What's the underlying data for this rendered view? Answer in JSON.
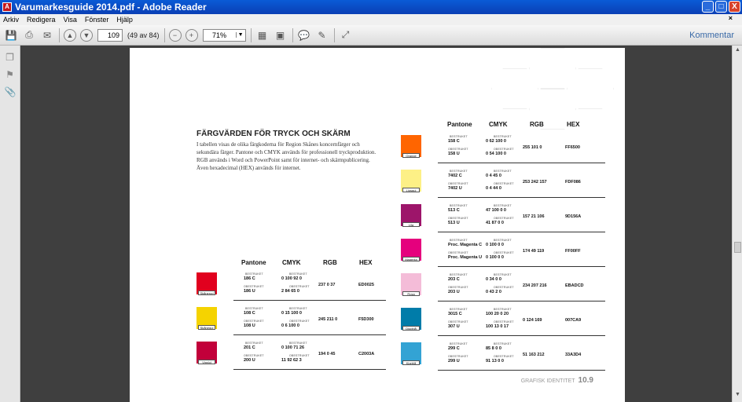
{
  "window": {
    "title": "Varumarkesguide 2014.pdf - Adobe Reader",
    "min": "_",
    "max": "□",
    "close": "X"
  },
  "menu": [
    "Arkiv",
    "Redigera",
    "Visa",
    "Fönster",
    "Hjälp"
  ],
  "menu_close": "×",
  "toolbar": {
    "page_value": "109",
    "page_count": "(49 av 84)",
    "zoom": "71%",
    "comment_label": "Kommentar"
  },
  "document": {
    "heading": "FÄRGVÄRDEN FÖR TRYCK OCH SKÄRM",
    "intro": "I tabellen visas de olika färgkoderna för Region Skånes koncernfärger och sekundära färger. Pantone och CMYK används för professionell tryckproduktion. RGB används i Word och PowerPoint samt för internet- och skärmpublicering. Även hexadecimal (HEX) används för internet.",
    "columns": {
      "pantone": "Pantone",
      "cmyk": "CMYK",
      "rgb": "RGB",
      "hex": "HEX"
    },
    "coated_label": "BESTRUKET",
    "uncoated_label": "OBESTRUKET",
    "left_rows": [
      {
        "name": "Skånerod",
        "color": "#e1001e",
        "p1": "186 C",
        "c1": "0  100  92  0",
        "p2": "186 U",
        "c2": "2  84  65  0",
        "rgb": "237 0 37",
        "hex": "ED0025"
      },
      {
        "name": "Skånegul",
        "color": "#f5d300",
        "p1": "108 C",
        "c1": "0  15  100  0",
        "p2": "108 U",
        "c2": "0  6  100  0",
        "rgb": "245 211 0",
        "hex": "F5D300"
      },
      {
        "name": "Vinröd",
        "color": "#c2003a",
        "p1": "201 C",
        "c1": "0  100  71  26",
        "p2": "200 U",
        "c2": "11  92  62  3",
        "rgb": "194 0 45",
        "hex": "C2003A"
      }
    ],
    "right_rows": [
      {
        "name": "Orange",
        "color": "#ff6500",
        "p1": "158 C",
        "c1": "0  62  100  0",
        "p2": "158 U",
        "c2": "0  54  100  0",
        "rgb": "255 101 0",
        "hex": "FF6500"
      },
      {
        "name": "Ljusgul",
        "color": "#fdf086",
        "p1": "7402 C",
        "c1": "0  4  45  0",
        "p2": "7402 U",
        "c2": "0  4  44  0",
        "rgb": "253 242 157",
        "hex": "FDF086"
      },
      {
        "name": "Lila",
        "color": "#9d156a",
        "p1": "513 C",
        "c1": "47  100  0  0",
        "p2": "513 U",
        "c2": "41  87  0  0",
        "rgb": "157 21 106",
        "hex": "9D156A"
      },
      {
        "name": "Magenta",
        "color": "#e5007d",
        "p1": "Proc. Magenta C",
        "c1": "0  100  0  0",
        "p2": "Proc. Magenta U",
        "c2": "0  100  0  0",
        "rgb": "174 49 119",
        "hex": "FF00FF"
      },
      {
        "name": "Rosa",
        "color": "#f4bcd8",
        "p1": "203 C",
        "c1": "0  34  0  0",
        "p2": "203 U",
        "c2": "0  43  2  0",
        "rgb": "234 207 216",
        "hex": "EBADCD"
      },
      {
        "name": "Djupblå",
        "color": "#007ca9",
        "p1": "3015 C",
        "c1": "100  20  0  20",
        "p2": "307 U",
        "c2": "100  13  0  17",
        "rgb": "0 124 169",
        "hex": "007CA9"
      },
      {
        "name": "Klarblå",
        "color": "#33a3d4",
        "p1": "299 C",
        "c1": "85  8  0  0",
        "p2": "299 U",
        "c2": "91  13  0  0",
        "rgb": "51 163 212",
        "hex": "33A3D4"
      }
    ],
    "footer_label": "GRAFISK IDENTITET",
    "footer_page": "10.9"
  }
}
